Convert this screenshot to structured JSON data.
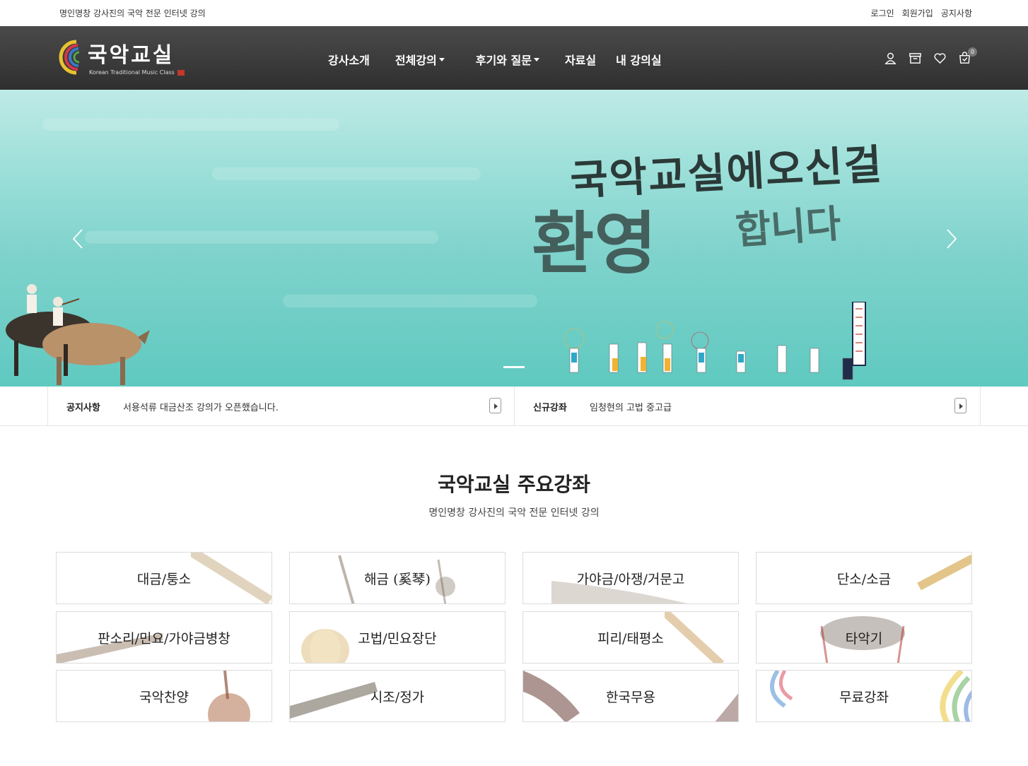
{
  "topbar": {
    "tagline": "명인명창 강사진의 국악 전문 인터넷 강의",
    "links": [
      "로그인",
      "회원가입",
      "공지사항"
    ]
  },
  "header": {
    "logo_text": "국악교실",
    "logo_sub": "Korean Traditional Music Class",
    "nav": [
      {
        "label": "강사소개",
        "dropdown": false
      },
      {
        "label": "전체강의",
        "dropdown": true
      },
      {
        "label": "후기와 질문",
        "dropdown": true
      },
      {
        "label": "자료실",
        "dropdown": false
      },
      {
        "label": "내 강의실",
        "dropdown": false
      }
    ],
    "icons": [
      "user-icon",
      "archive-icon",
      "heart-icon",
      "cart-icon"
    ],
    "cart_count": "0"
  },
  "hero": {
    "headline_line1": "국악교실에오신걸",
    "headline_big": "환영",
    "headline_line2": "합니다",
    "slide_count": 1,
    "active_slide": 1
  },
  "notice": {
    "notice_label": "공지사항",
    "notice_text": "서용석류 대금산조 강의가 오픈했습니다.",
    "new_label": "신규강좌",
    "new_text": "임청현의 고법 중고급"
  },
  "section": {
    "title": "국악교실 주요강좌",
    "subtitle": "명인명창 강사진의 국악 전문 인터넷 강의"
  },
  "categories": [
    "대금/퉁소",
    "해금 (奚琴)",
    "가야금/아쟁/거문고",
    "단소/소금",
    "판소리/민요/가야금병창",
    "고법/민요장단",
    "피리/태평소",
    "타악기",
    "국악찬양",
    "시조/정가",
    "한국무용",
    "무료강좌"
  ],
  "colors": {
    "header_bg": "#3a3a3a",
    "hero_sea": "#7fd3cc",
    "border": "#dcdcdc"
  }
}
